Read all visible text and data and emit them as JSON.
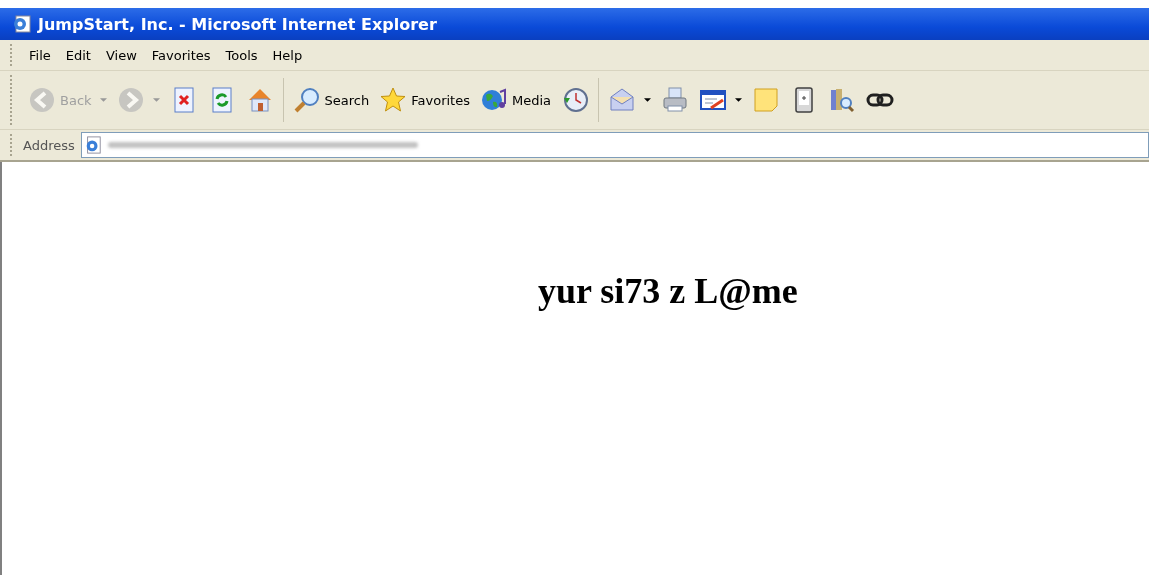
{
  "window": {
    "title": "JumpStart, Inc. - Microsoft Internet Explorer"
  },
  "menu": [
    "File",
    "Edit",
    "View",
    "Favorites",
    "Tools",
    "Help"
  ],
  "toolbar": [
    {
      "kind": "button",
      "label": "Back",
      "disabled": true,
      "dropdown": true
    },
    {
      "kind": "button",
      "disabled": true,
      "dropdown": true
    },
    {
      "kind": "button",
      "disabled": false,
      "dropdown": false
    },
    {
      "kind": "button",
      "disabled": false,
      "dropdown": false
    },
    {
      "kind": "button",
      "disabled": false,
      "dropdown": false
    },
    {
      "kind": "separator"
    },
    {
      "kind": "button",
      "label": "Search",
      "disabled": false,
      "dropdown": false
    },
    {
      "kind": "button",
      "label": "Favorites",
      "disabled": false,
      "dropdown": false
    },
    {
      "kind": "button",
      "label": "Media",
      "disabled": false,
      "dropdown": false
    },
    {
      "kind": "button",
      "disabled": false,
      "dropdown": false
    },
    {
      "kind": "separator"
    },
    {
      "kind": "button",
      "disabled": false,
      "dropdown": true
    },
    {
      "kind": "button",
      "disabled": false,
      "dropdown": false
    },
    {
      "kind": "button",
      "disabled": false,
      "dropdown": true
    },
    {
      "kind": "button",
      "disabled": false,
      "dropdown": false
    },
    {
      "kind": "button",
      "disabled": false,
      "dropdown": false
    },
    {
      "kind": "button",
      "disabled": false,
      "dropdown": false
    },
    {
      "kind": "button",
      "disabled": false,
      "dropdown": false
    }
  ],
  "address": {
    "label": "Address"
  },
  "page": {
    "heading": "yur si73 z L@me"
  }
}
